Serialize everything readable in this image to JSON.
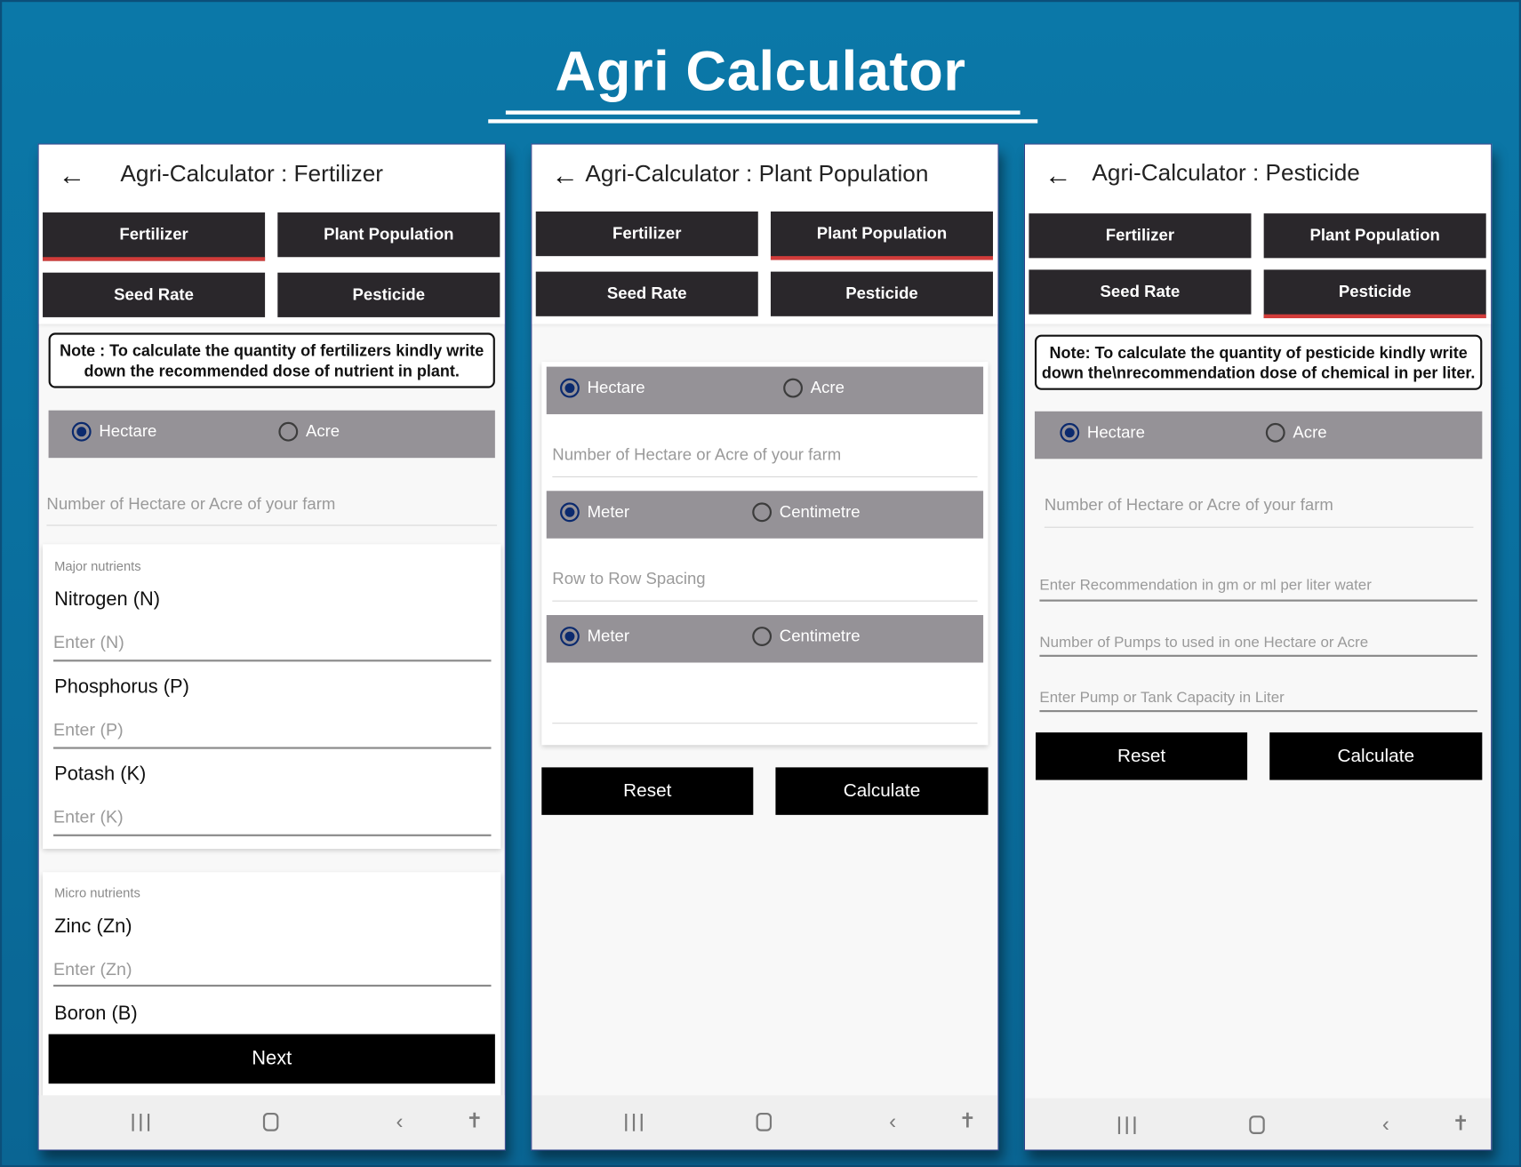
{
  "page": {
    "title": "Agri Calculator",
    "background_color": "#0a6f9e",
    "active_tab_color": "#d23c3a",
    "radio_checked_color": "#0b2a6e"
  },
  "tabs": [
    "Fertilizer",
    "Plant Population",
    "Seed Rate",
    "Pesticide"
  ],
  "common": {
    "back_icon": "arrow-left-icon",
    "hectare": "Hectare",
    "acre": "Acre",
    "meter": "Meter",
    "centimetre": "Centimetre",
    "farm_placeholder": "Number of Hectare or Acre of your farm",
    "reset": "Reset",
    "calculate": "Calculate",
    "nav_icons": [
      "recent-apps-icon",
      "home-icon",
      "back-nav-icon",
      "accessibility-icon"
    ]
  },
  "fertilizer": {
    "app_title": "Agri-Calculator : Fertilizer",
    "active_tab": "Fertilizer",
    "note": "Note : To calculate the quantity of fertilizers kindly write down the recommended dose of nutrient in plant.",
    "unit_selected": "Hectare",
    "major_label": "Major nutrients",
    "major": [
      {
        "label": "Nitrogen (N)",
        "placeholder": "Enter (N)"
      },
      {
        "label": "Phosphorus (P)",
        "placeholder": "Enter (P)"
      },
      {
        "label": "Potash (K)",
        "placeholder": "Enter (K)"
      }
    ],
    "micro_label": "Micro nutrients",
    "micro": [
      {
        "label": "Zinc (Zn)",
        "placeholder": "Enter (Zn)"
      },
      {
        "label": "Boron (B)"
      }
    ],
    "next": "Next"
  },
  "plant_population": {
    "app_title": "Agri-Calculator : Plant Population",
    "active_tab": "Plant Population",
    "unit_selected": "Hectare",
    "row_spacing_placeholder": "Row to Row Spacing",
    "spacing_unit_1_selected": "Meter",
    "spacing_unit_2_selected": "Meter"
  },
  "pesticide": {
    "app_title": "Agri-Calculator : Pesticide",
    "active_tab": "Pesticide",
    "note": "Note: To calculate the quantity of pesticide kindly write down the\\nrecommendation dose of chemical in per liter.",
    "unit_selected": "Hectare",
    "recommendation_placeholder": "Enter Recommendation in gm or ml per liter water",
    "pumps_placeholder": "Number of Pumps to used in one Hectare or Acre",
    "capacity_placeholder": "Enter Pump or Tank Capacity in Liter"
  }
}
